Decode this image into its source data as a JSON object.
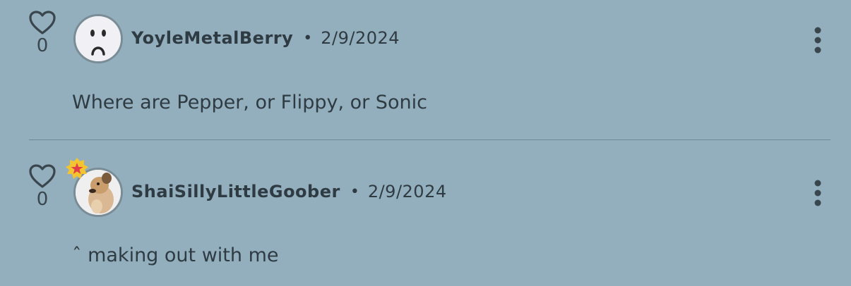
{
  "comments": [
    {
      "username": "YoyleMetalBerry",
      "separator": "•",
      "date": "2/9/2024",
      "body": "Where are Pepper, or Flippy, or Sonic",
      "likes": "0",
      "avatar_icon": "sad-face-avatar",
      "has_badge": false
    },
    {
      "username": "ShaiSillyLittleGoober",
      "separator": "•",
      "date": "2/9/2024",
      "body": "ˆ making out with me",
      "likes": "0",
      "avatar_icon": "dog-photo-avatar",
      "has_badge": true,
      "badge_icon": "star-badge-icon"
    }
  ],
  "colors": {
    "background": "#93afbd",
    "text": "#2f3b42",
    "badge_yellow": "#f4c430",
    "badge_star": "#e23c4a"
  }
}
